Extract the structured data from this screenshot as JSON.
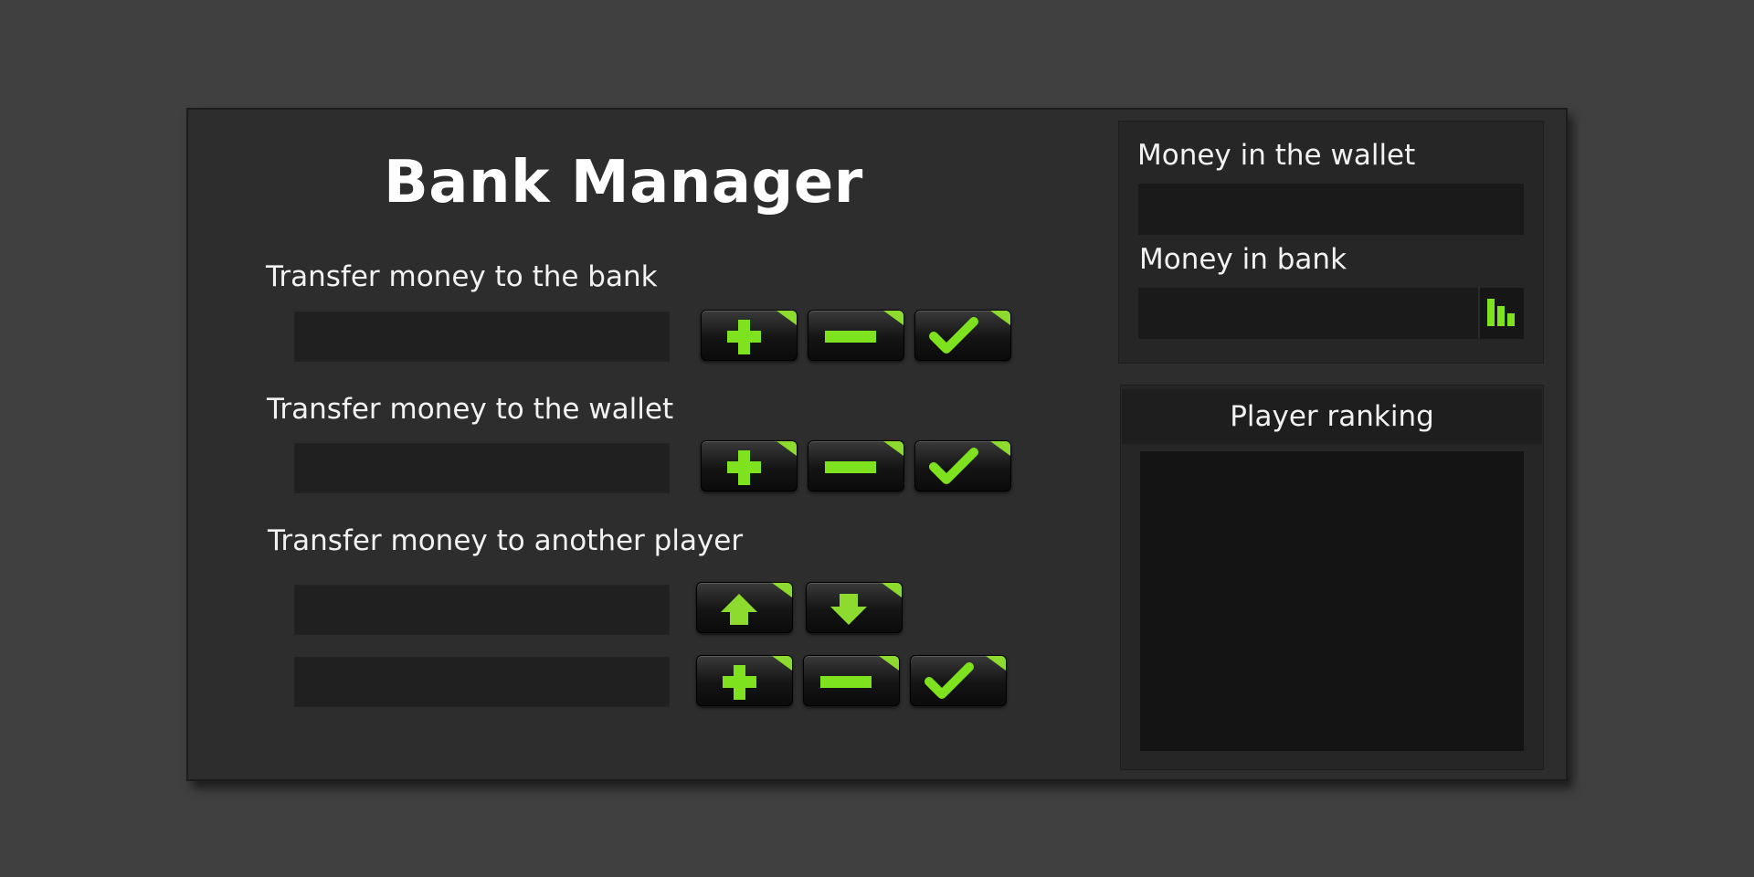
{
  "app": {
    "title": "Bank Manager"
  },
  "transfer_to_bank": {
    "label": "Transfer money to the bank",
    "amount_value": ""
  },
  "transfer_to_wallet": {
    "label": "Transfer money to the wallet",
    "amount_value": ""
  },
  "transfer_to_player": {
    "label": "Transfer money to another player",
    "player_value": "",
    "amount_value": ""
  },
  "balances": {
    "wallet_label": "Money in the wallet",
    "wallet_value": "",
    "bank_label": "Money in bank",
    "bank_value": ""
  },
  "ranking": {
    "header": "Player ranking",
    "entries": []
  },
  "icons": {
    "increase": "plus-icon",
    "decrease": "minus-icon",
    "confirm": "check-icon",
    "previous_player": "arrow-up-icon",
    "next_player": "arrow-down-icon",
    "statistics": "bar-chart-icon"
  },
  "colors": {
    "accent": "#7ee21e",
    "panel": "#2d2d2d",
    "field": "#202020",
    "background": "#404040"
  }
}
